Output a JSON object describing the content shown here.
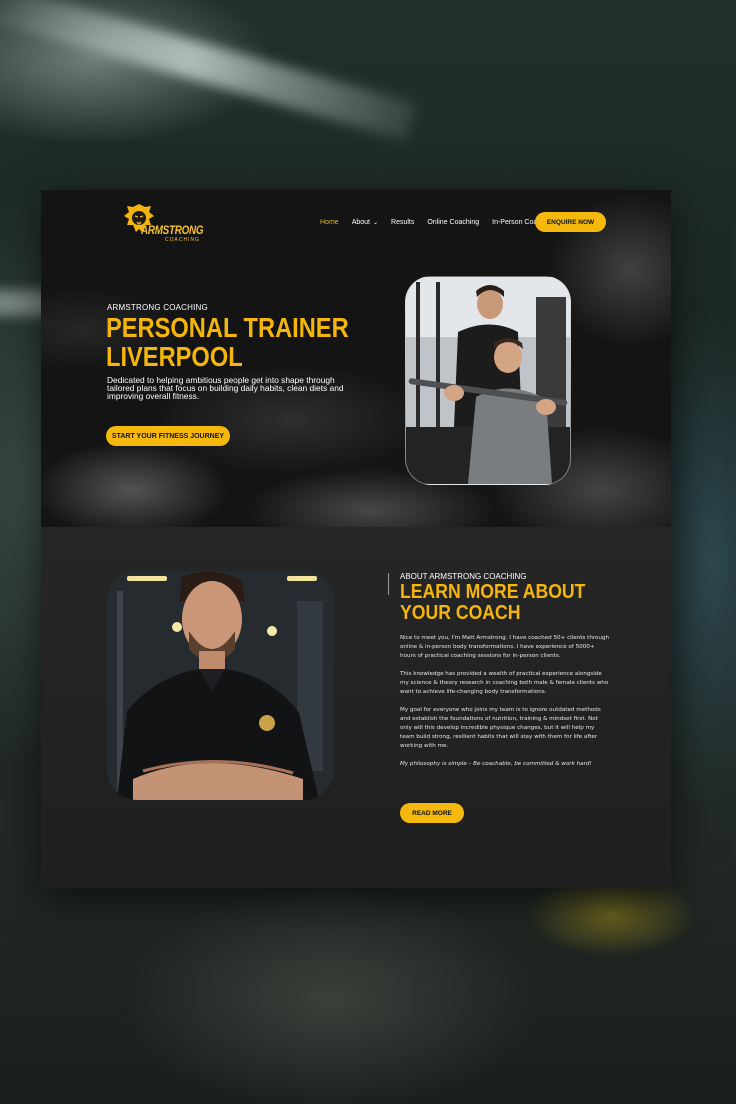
{
  "brand": {
    "name": "ARMSTRONG",
    "tagline": "COACHING",
    "accent_color": "#f5b80c",
    "logo_icon": "lion-head-icon"
  },
  "nav": {
    "items": [
      {
        "label": "Home",
        "active": true
      },
      {
        "label": "About",
        "has_dropdown": true
      },
      {
        "label": "Results"
      },
      {
        "label": "Online Coaching"
      },
      {
        "label": "In-Person Coaching"
      }
    ],
    "cta_label": "ENQUIRE NOW"
  },
  "hero": {
    "eyebrow": "ARMSTRONG COACHING",
    "title_line1": "PERSONAL TRAINER",
    "title_line2": "LIVERPOOL",
    "description": "Dedicated to helping ambitious people get into shape through tailored plans that focus on building daily habits, clean diets and improving overall fitness.",
    "cta_label": "START YOUR FITNESS JOURNEY"
  },
  "about": {
    "eyebrow": "ABOUT ARMSTRONG COACHING",
    "title_line1": "LEARN MORE ABOUT",
    "title_line2": "YOUR COACH",
    "paragraphs": [
      "Nice to meet you, I'm Matt Armstrong. I have coached 50+ clients through online & in-person body transformations. I have experience of 5000+ hours of practical coaching sessions for in-person clients.",
      "This knowledge has provided a wealth of practical experience alongside my science & theory research in coaching both male & female clients who want to achieve life-changing body transformations.",
      "My goal for everyone who joins my team is to ignore outdated methods and establish the foundations of nutrition, training & mindset first. Not only will this develop incredible physique changes, but it will help my team build strong, resilient habits that will stay with them for life after working with me."
    ],
    "quote": "My philosophy is simple – Be coachable, be committed & work hard!",
    "cta_label": "READ MORE"
  }
}
